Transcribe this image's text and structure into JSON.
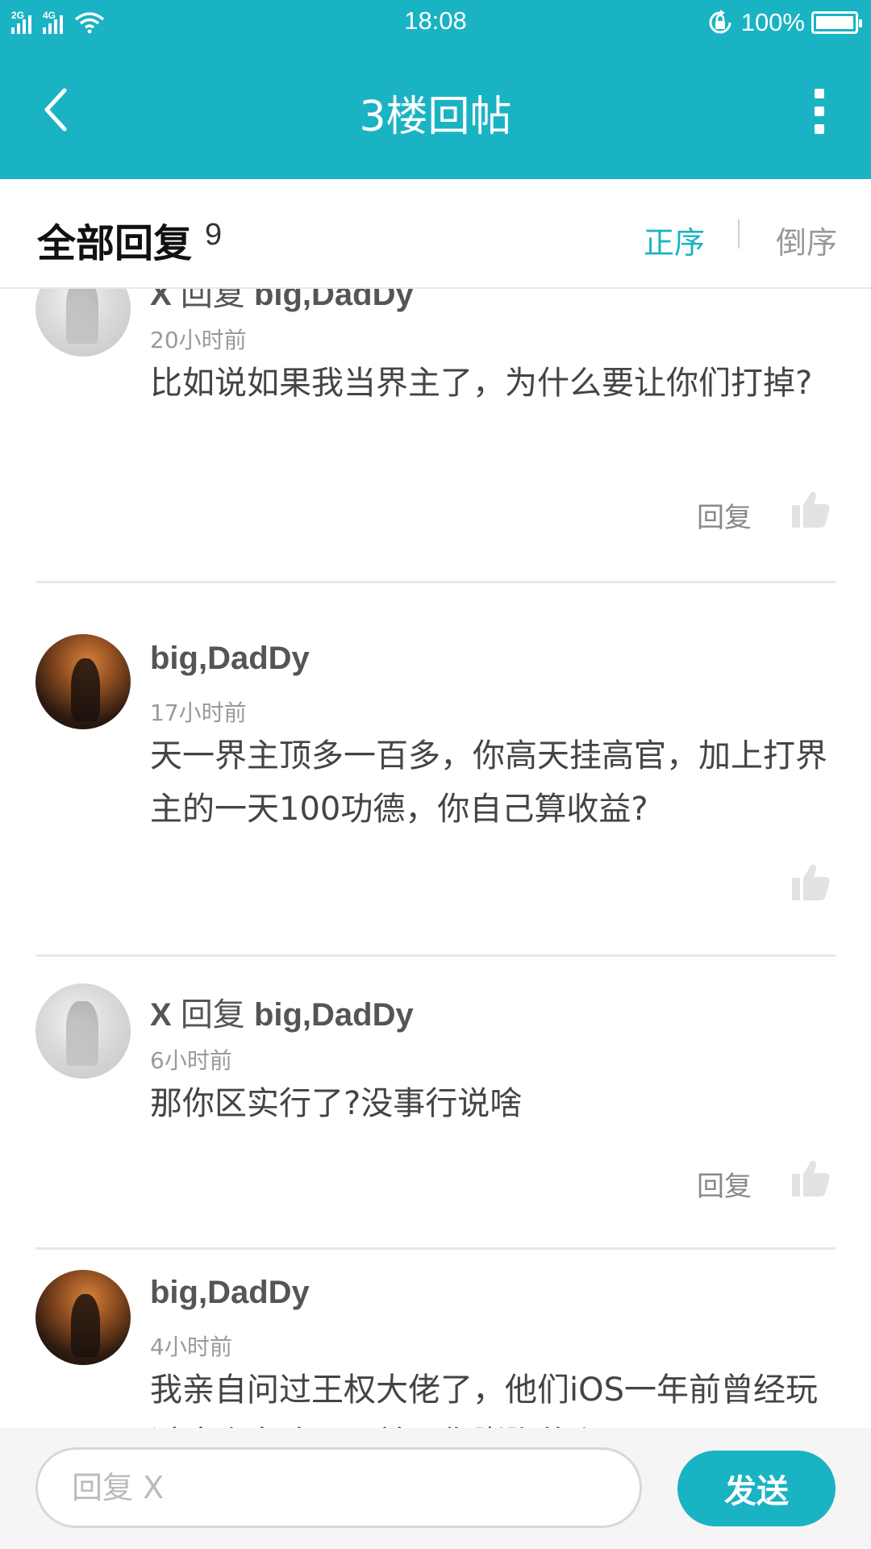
{
  "status_bar": {
    "network_1": "2G",
    "network_2": "4G",
    "time": "18:08",
    "battery": "100%",
    "battery_level": 1.0,
    "icons": [
      "signal-icon",
      "wifi-icon",
      "lock-rotation-icon",
      "battery-icon"
    ]
  },
  "app_bar": {
    "title": "3楼回帖",
    "back_icon": "chevron-left-icon",
    "more_icon": "more-vertical-icon"
  },
  "sort_header": {
    "title": "全部回复",
    "count": "9",
    "ascending_label": "正序",
    "descending_label": "倒序",
    "active": "ascending"
  },
  "replies": [
    {
      "author": "X",
      "reply_word": "回复",
      "reply_to": "big,DadDy",
      "time": "20小时前",
      "content": "比如说如果我当界主了，为什么要让你们打掉?",
      "action_label": "回复",
      "avatar": "light"
    },
    {
      "author": "big,DadDy",
      "time": "17小时前",
      "content": "天一界主顶多一百多，你高天挂高官，加上打界主的一天100功德，你自己算收益?",
      "avatar": "dark"
    },
    {
      "author": "X",
      "reply_word": "回复",
      "reply_to": "big,DadDy",
      "time": "6小时前",
      "content": "那你区实行了?没事行说啥",
      "action_label": "回复",
      "avatar": "light"
    },
    {
      "author": "big,DadDy",
      "time": "4小时前",
      "content": "我亲自问过王权大佬了，他们iOS一年前曾经玩过这个套路，兄弟，你膨胀什么",
      "avatar": "dark"
    }
  ],
  "bottom_bar": {
    "input_placeholder": "回复 X",
    "input_value": "",
    "send_label": "发送"
  },
  "colors": {
    "accent": "#1ab3c3",
    "text_primary": "#444444",
    "text_muted": "#9a9a9a",
    "divider": "#e8e8e8"
  }
}
